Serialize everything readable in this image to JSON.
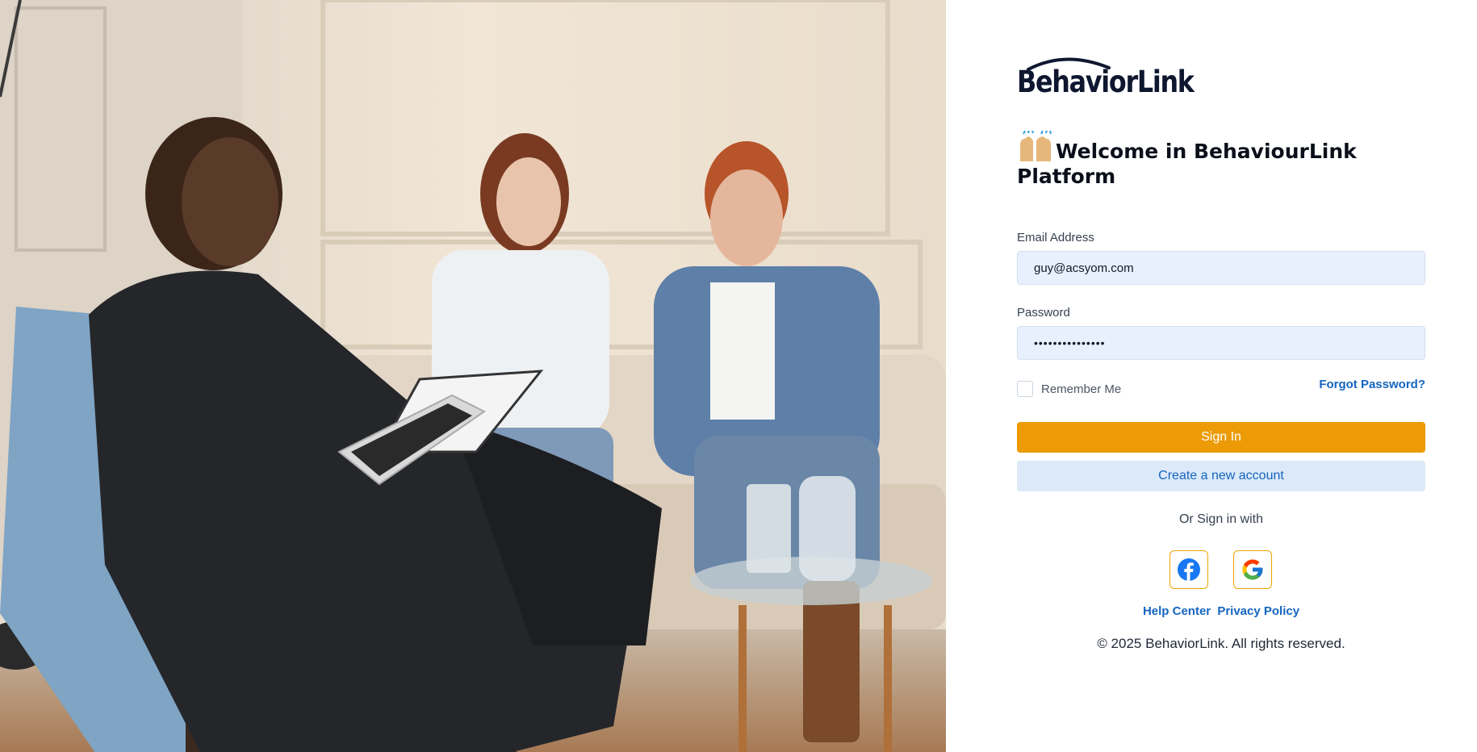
{
  "brand": {
    "logo_text": "BehaviorLink"
  },
  "welcome": {
    "emoji_icon": "raised-hands-emoji",
    "title": "Welcome in BehaviourLink Platform"
  },
  "form": {
    "email_label": "Email Address",
    "email_value": "guy@acsyom.com",
    "password_label": "Password",
    "password_value": "•••••••••••••••",
    "remember_label": "Remember Me",
    "remember_checked": false,
    "forgot_label": "Forgot Password?",
    "signin_label": "Sign In",
    "create_label": "Create a new account",
    "or_label": "Or Sign in with"
  },
  "social": [
    {
      "name": "facebook-icon",
      "color": "#1877f2"
    },
    {
      "name": "google-icon",
      "color": "#4285f4"
    }
  ],
  "footer": {
    "help_label": "Help Center",
    "privacy_label": "Privacy Policy",
    "copyright": "© 2025 BehaviorLink. All rights reserved."
  },
  "colors": {
    "primary": "#ec9b07",
    "link": "#1565c0",
    "secondary_bg": "#dce9f8",
    "input_bg": "#e8f0fe"
  }
}
